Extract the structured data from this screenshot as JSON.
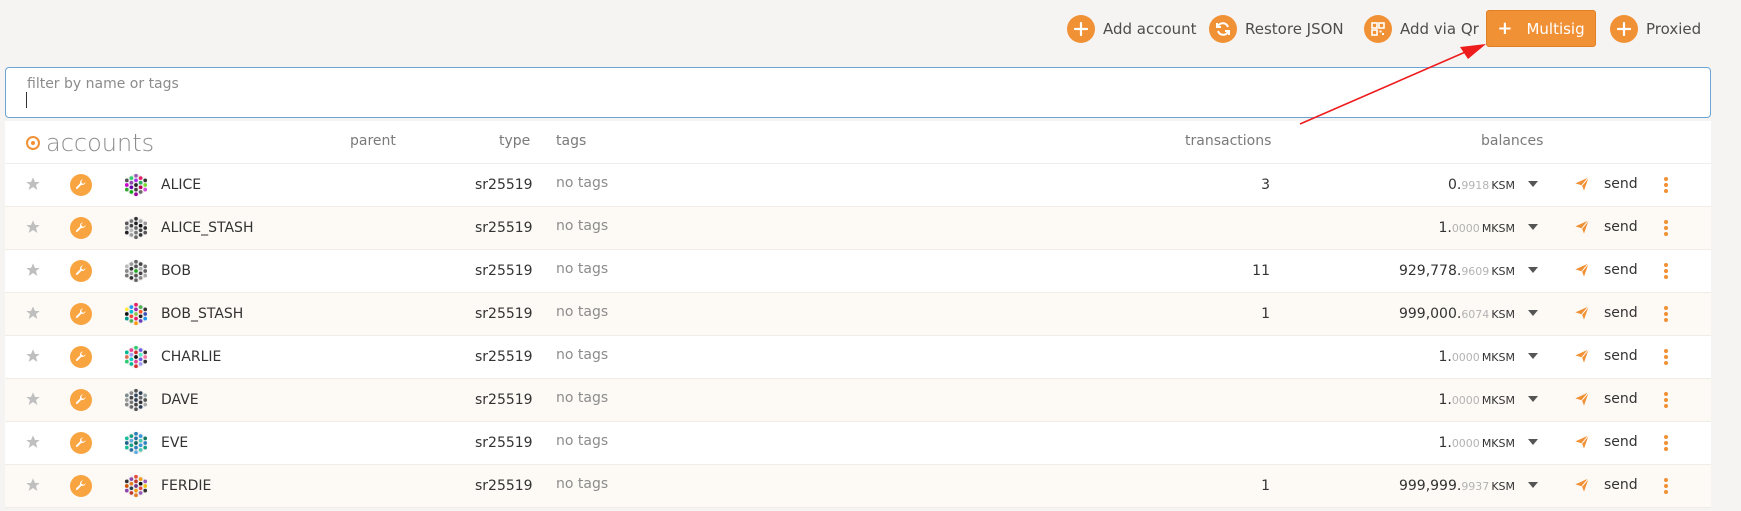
{
  "toolbar": {
    "add_account": "Add account",
    "restore_json": "Restore JSON",
    "add_via_qr": "Add via Qr",
    "multisig": "Multisig",
    "proxied": "Proxied"
  },
  "filter": {
    "label": "filter by name or tags",
    "value": ""
  },
  "table": {
    "title": "accounts",
    "headers": {
      "parent": "parent",
      "type": "type",
      "tags": "tags",
      "transactions": "transactions",
      "balances": "balances"
    },
    "send_label": "send",
    "rows": [
      {
        "name": "ALICE",
        "type": "sr25519",
        "tags": "no tags",
        "transactions": "3",
        "bal_int": "0.",
        "bal_frac": "9918",
        "bal_unit": "KSM",
        "identicon": [
          "#9b59b6",
          "#2ecc71",
          "#e91e63",
          "#555",
          "#a3e",
          "#333",
          "#8e44ad",
          "#27ae60",
          "#c0c",
          "#222",
          "#7d3",
          "#60a",
          "#b05",
          "#3a3",
          "#444",
          "#d4d",
          "#1a1",
          "#666",
          "#909"
        ]
      },
      {
        "name": "ALICE_STASH",
        "type": "sr25519",
        "tags": "no tags",
        "transactions": "",
        "bal_int": "1.",
        "bal_frac": "0000",
        "bal_unit": "MKSM",
        "identicon": [
          "#333",
          "#777",
          "#aaa",
          "#555",
          "#222",
          "#999",
          "#444",
          "#111",
          "#888",
          "#666",
          "#333",
          "#bbb",
          "#444",
          "#222",
          "#777",
          "#555",
          "#999",
          "#333",
          "#666"
        ]
      },
      {
        "name": "BOB",
        "type": "sr25519",
        "tags": "no tags",
        "transactions": "11",
        "bal_int": "929,778.",
        "bal_frac": "9609",
        "bal_unit": "KSM",
        "identicon": [
          "#666",
          "#999",
          "#444",
          "#bbb",
          "#555",
          "#777",
          "#333",
          "#aaa",
          "#888",
          "#2a2",
          "#666",
          "#999",
          "#444",
          "#777",
          "#555",
          "#aaa",
          "#333",
          "#888",
          "#666"
        ]
      },
      {
        "name": "BOB_STASH",
        "type": "sr25519",
        "tags": "no tags",
        "transactions": "1",
        "bal_int": "999,000.",
        "bal_frac": "6074",
        "bal_unit": "KSM",
        "identicon": [
          "#e91e63",
          "#2196f3",
          "#4caf50",
          "#ffeb3b",
          "#9c27b0",
          "#333",
          "#00bcd4",
          "#ff5722",
          "#111",
          "#8bc34a",
          "#3f51b5",
          "#f44336",
          "#222",
          "#009688",
          "#e91e63",
          "#2196f3",
          "#4caf50",
          "#673ab7",
          "#ff9800"
        ]
      },
      {
        "name": "CHARLIE",
        "type": "sr25519",
        "tags": "no tags",
        "transactions": "",
        "bal_int": "1.",
        "bal_frac": "0000",
        "bal_unit": "MKSM",
        "identicon": [
          "#2ecc71",
          "#e84393",
          "#6c5ce7",
          "#00b894",
          "#d63031",
          "#333",
          "#a29bfe",
          "#55efc4",
          "#e17055",
          "#111",
          "#fd79a8",
          "#00cec9",
          "#6c5ce7",
          "#2ecc71",
          "#e84393",
          "#333",
          "#00b894",
          "#a29bfe",
          "#d63031"
        ]
      },
      {
        "name": "DAVE",
        "type": "sr25519",
        "tags": "no tags",
        "transactions": "",
        "bal_int": "1.",
        "bal_frac": "0000",
        "bal_unit": "MKSM",
        "identicon": [
          "#555",
          "#888",
          "#2c3e50",
          "#7f8c8d",
          "#34495e",
          "#95a5a6",
          "#444",
          "#666",
          "#999",
          "#2c3e50",
          "#555",
          "#777",
          "#333",
          "#888",
          "#444",
          "#aaa",
          "#666",
          "#2c3e50",
          "#555"
        ]
      },
      {
        "name": "EVE",
        "type": "sr25519",
        "tags": "no tags",
        "transactions": "",
        "bal_int": "1.",
        "bal_frac": "0000",
        "bal_unit": "MKSM",
        "identicon": [
          "#2980b9",
          "#16a085",
          "#3498db",
          "#1abc9c",
          "#2471a3",
          "#117a65",
          "#5dade2",
          "#48c9b0",
          "#1f618d",
          "#0e6655",
          "#2e86c1",
          "#17a589",
          "#3498db",
          "#1abc9c",
          "#2980b9",
          "#16a085",
          "#2471a3",
          "#48c9b0",
          "#5dade2"
        ]
      },
      {
        "name": "FERDIE",
        "type": "sr25519",
        "tags": "no tags",
        "transactions": "1",
        "bal_int": "999,999.",
        "bal_frac": "9937",
        "bal_unit": "KSM",
        "identicon": [
          "#e74c3c",
          "#8e44ad",
          "#f39c12",
          "#333",
          "#c0392b",
          "#9b59b6",
          "#e67e22",
          "#111",
          "#d35400",
          "#6c3483",
          "#f1c40f",
          "#2c3e50",
          "#e74c3c",
          "#8e44ad",
          "#f39c12",
          "#333",
          "#c0392b",
          "#9b59b6",
          "#e67e22"
        ]
      }
    ]
  },
  "colors": {
    "accent": "#f19135",
    "annotation_arrow": "#ee1c1c"
  }
}
